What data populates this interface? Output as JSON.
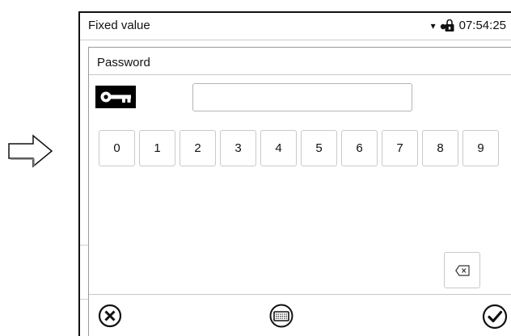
{
  "status_bar": {
    "title": "Fixed value",
    "dropdown_glyph": "▾",
    "time": "07:54:25",
    "icons": [
      "dropdown-arrow-icon",
      "lock-icon"
    ]
  },
  "dialog": {
    "title": "Password",
    "password_value": "",
    "keypad": [
      "0",
      "1",
      "2",
      "3",
      "4",
      "5",
      "6",
      "7",
      "8",
      "9"
    ],
    "icons": [
      "key-icon",
      "backspace-icon",
      "cancel-icon",
      "keyboard-icon",
      "confirm-icon"
    ]
  },
  "decor": {
    "arrow_icon": "right-arrow-icon"
  }
}
